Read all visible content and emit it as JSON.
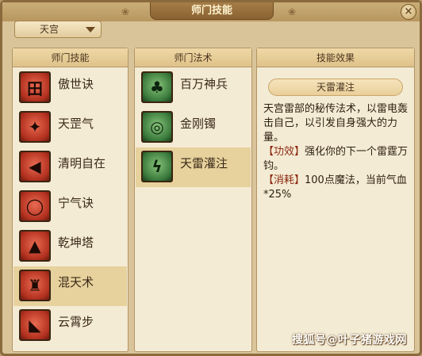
{
  "window": {
    "title": "师门技能",
    "close_label": "×"
  },
  "sect_dropdown": {
    "selected": "天宫"
  },
  "skills_panel": {
    "header": "师门技能",
    "items": [
      {
        "label": "傲世诀",
        "icon_glyph": "田"
      },
      {
        "label": "天罡气",
        "icon_glyph": "✦"
      },
      {
        "label": "清明自在",
        "icon_glyph": "◀"
      },
      {
        "label": "宁气诀",
        "icon_glyph": "◯"
      },
      {
        "label": "乾坤塔",
        "icon_glyph": "▲"
      },
      {
        "label": "混天术",
        "icon_glyph": "♜"
      },
      {
        "label": "云霄步",
        "icon_glyph": "◣"
      }
    ],
    "selected_index": 5
  },
  "spells_panel": {
    "header": "师门法术",
    "items": [
      {
        "label": "百万神兵",
        "icon_glyph": "♣"
      },
      {
        "label": "金刚镯",
        "icon_glyph": "◎"
      },
      {
        "label": "天雷灌注",
        "icon_glyph": "ϟ"
      }
    ],
    "selected_index": 2
  },
  "effect_panel": {
    "header": "技能效果",
    "skill_name": "天雷灌注",
    "description": "天宫雷部的秘传法术，以雷电轰击自己，以引发自身强大的力量。",
    "effect_label": "【功效】",
    "effect_text": "强化你的下一个雷霆万钧。",
    "cost_label": "【消耗】",
    "cost_text": "100点魔法，当前气血*25%"
  },
  "watermark": "搜狐号@叶子猪游戏网",
  "colors": {
    "window_bg": "#d9c49a",
    "panel_bg": "#f4ebd4",
    "selected_row": "#e7d19c",
    "tag_color": "#8b2a10"
  }
}
